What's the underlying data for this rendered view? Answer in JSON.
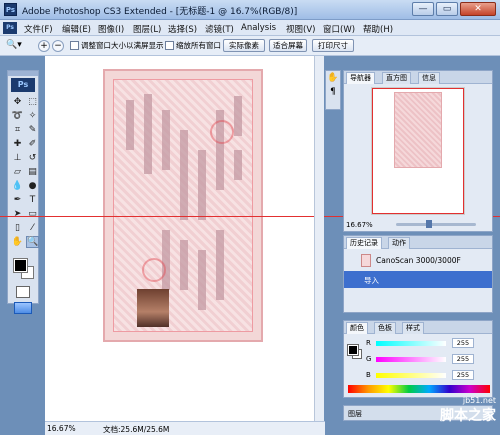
{
  "window": {
    "title": "Adobe Photoshop CS3 Extended - [无标题-1 @ 16.7%(RGB/8)]",
    "app_icon": "Ps",
    "minimize": "—",
    "maximize": "▭",
    "close": "✕"
  },
  "menu": [
    "文件(F)",
    "编辑(E)",
    "图像(I)",
    "图层(L)",
    "选择(S)",
    "滤镜(T)",
    "Analysis",
    "视图(V)",
    "窗口(W)",
    "帮助(H)"
  ],
  "options": {
    "zoom_tool_icon": "zoom-icon",
    "check1": "调整窗口大小以满屏显示",
    "check2": "缩放所有窗口",
    "actual_pixels": "实际像素",
    "fit_screen": "适合屏幕",
    "print_size": "打印尺寸"
  },
  "toolbox": {
    "logo": "Ps"
  },
  "status": {
    "zoom": "16.67%",
    "doc": "文档:25.6M/25.6M"
  },
  "navigator": {
    "tabs": [
      "导航器",
      "直方图",
      "信息"
    ],
    "zoom": "16.67%"
  },
  "history": {
    "tabs": [
      "历史记录",
      "动作"
    ],
    "items": [
      "CanoScan 3000/3000F",
      "导入"
    ]
  },
  "color": {
    "tabs": [
      "颜色",
      "色板",
      "样式"
    ],
    "channels": [
      {
        "label": "R",
        "value": "255"
      },
      {
        "label": "G",
        "value": "255"
      },
      {
        "label": "B",
        "value": "255"
      }
    ]
  },
  "bottom_panel": {
    "tab": "图层"
  },
  "watermark": {
    "line1": "jb51.net",
    "line2": "脚本之家"
  }
}
